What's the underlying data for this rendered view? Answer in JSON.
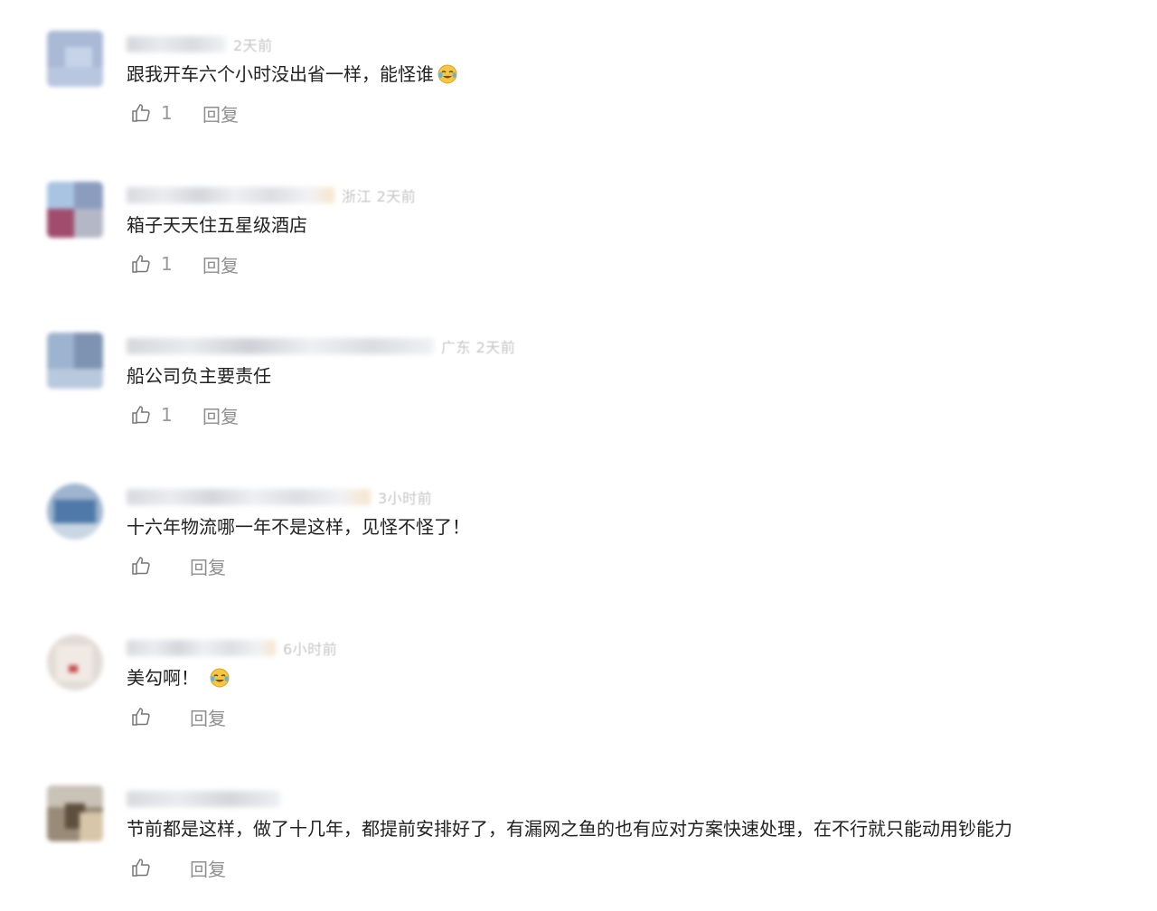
{
  "comments": [
    {
      "meta": "2天前",
      "text": "跟我开车六个小时没出省一样，能怪谁",
      "emoji": "laughing-cry-icon",
      "likes": "1",
      "reply_label": "回复"
    },
    {
      "meta": "浙江 2天前",
      "text": "箱子天天住五星级酒店",
      "emoji": "",
      "likes": "1",
      "reply_label": "回复"
    },
    {
      "meta": "广东 2天前",
      "text": "船公司负主要责任",
      "emoji": "",
      "likes": "1",
      "reply_label": "回复"
    },
    {
      "meta": "3小时前",
      "text": "十六年物流哪一年不是这样，见怪不怪了！",
      "emoji": "",
      "likes": "",
      "reply_label": "回复"
    },
    {
      "meta": "6小时前",
      "text": "美勾啊！",
      "emoji": "laughing-cry-icon",
      "likes": "",
      "reply_label": "回复"
    },
    {
      "meta": "",
      "text": "节前都是这样，做了十几年，都提前安排好了，有漏网之鱼的也有应对方案快速处理，在不行就只能动用钞能力",
      "emoji": "",
      "likes": "",
      "reply_label": "回复"
    }
  ],
  "colors": {
    "text": "#222222",
    "meta": "#c6c6c6",
    "action": "#8f8f8f"
  }
}
